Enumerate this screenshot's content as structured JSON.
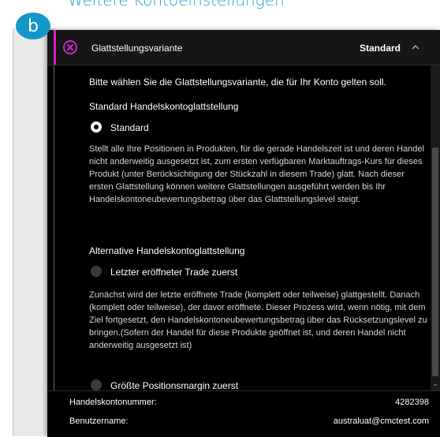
{
  "page": {
    "section_title": "Weitere Kontoeinstellungen",
    "step_badge": "b"
  },
  "header": {
    "label": "Glattstellungsvariante",
    "value": "Standard",
    "close_icon": "close-circle-icon",
    "chevron_icon": "chevron-up-icon",
    "accent_color": "#d223c8"
  },
  "content": {
    "intro": "Bitte wählen Sie die Glattstellungsvariante, die für Ihr Konto gelten soll.",
    "section1_title": "Standard Handelskontoglattstellung",
    "option_standard": {
      "label": "Standard",
      "selected": true,
      "description": "Stellt alle Ihre Positionen in Produkten, für die gerade Handelszeit ist und deren Handel nicht anderweitig ausgesetzt ist, zum ersten verfügbaren Marktauftrags-Kurs für dieses Produkt (unter Berücksichtigung der Stückzahl in diesem Trade) glatt. Nach dieser ersten Glattstellung können weitere Glattstellungen ausgeführt werden bis Ihr Handelskontoneubewertungsbetrag über das Glattstellungslevel steigt."
    },
    "section2_title": "Alternative Handelskontoglattstellung",
    "option_last_trade": {
      "label": "Letzter eröffneter Trade zuerst",
      "selected": false,
      "description": "Zunächst wird der letzte eröffnete Trade (komplett oder teilweise) glattgestellt. Danach (komplett oder teilweise), der davor eröffnete. Dieser Prozess wird, wenn nötig, mit dem Ziel fortgesetzt, den Handelskontoneubewertungsbetrag über das Rücksetzungslevel zu bringen.(Sofern der Handel für diese Produkte geöffnet ist, und deren Handel nicht anderweitig ausgesetzt ist)"
    },
    "option_largest_margin": {
      "label": "Größte Positionsmargin zuerst",
      "selected": false
    }
  },
  "footer": {
    "account_number_label": "Handelskontonummer:",
    "account_number_value": "4282398",
    "username_label": "Benutzername:",
    "username_value": "australuat@cmctest.com"
  }
}
